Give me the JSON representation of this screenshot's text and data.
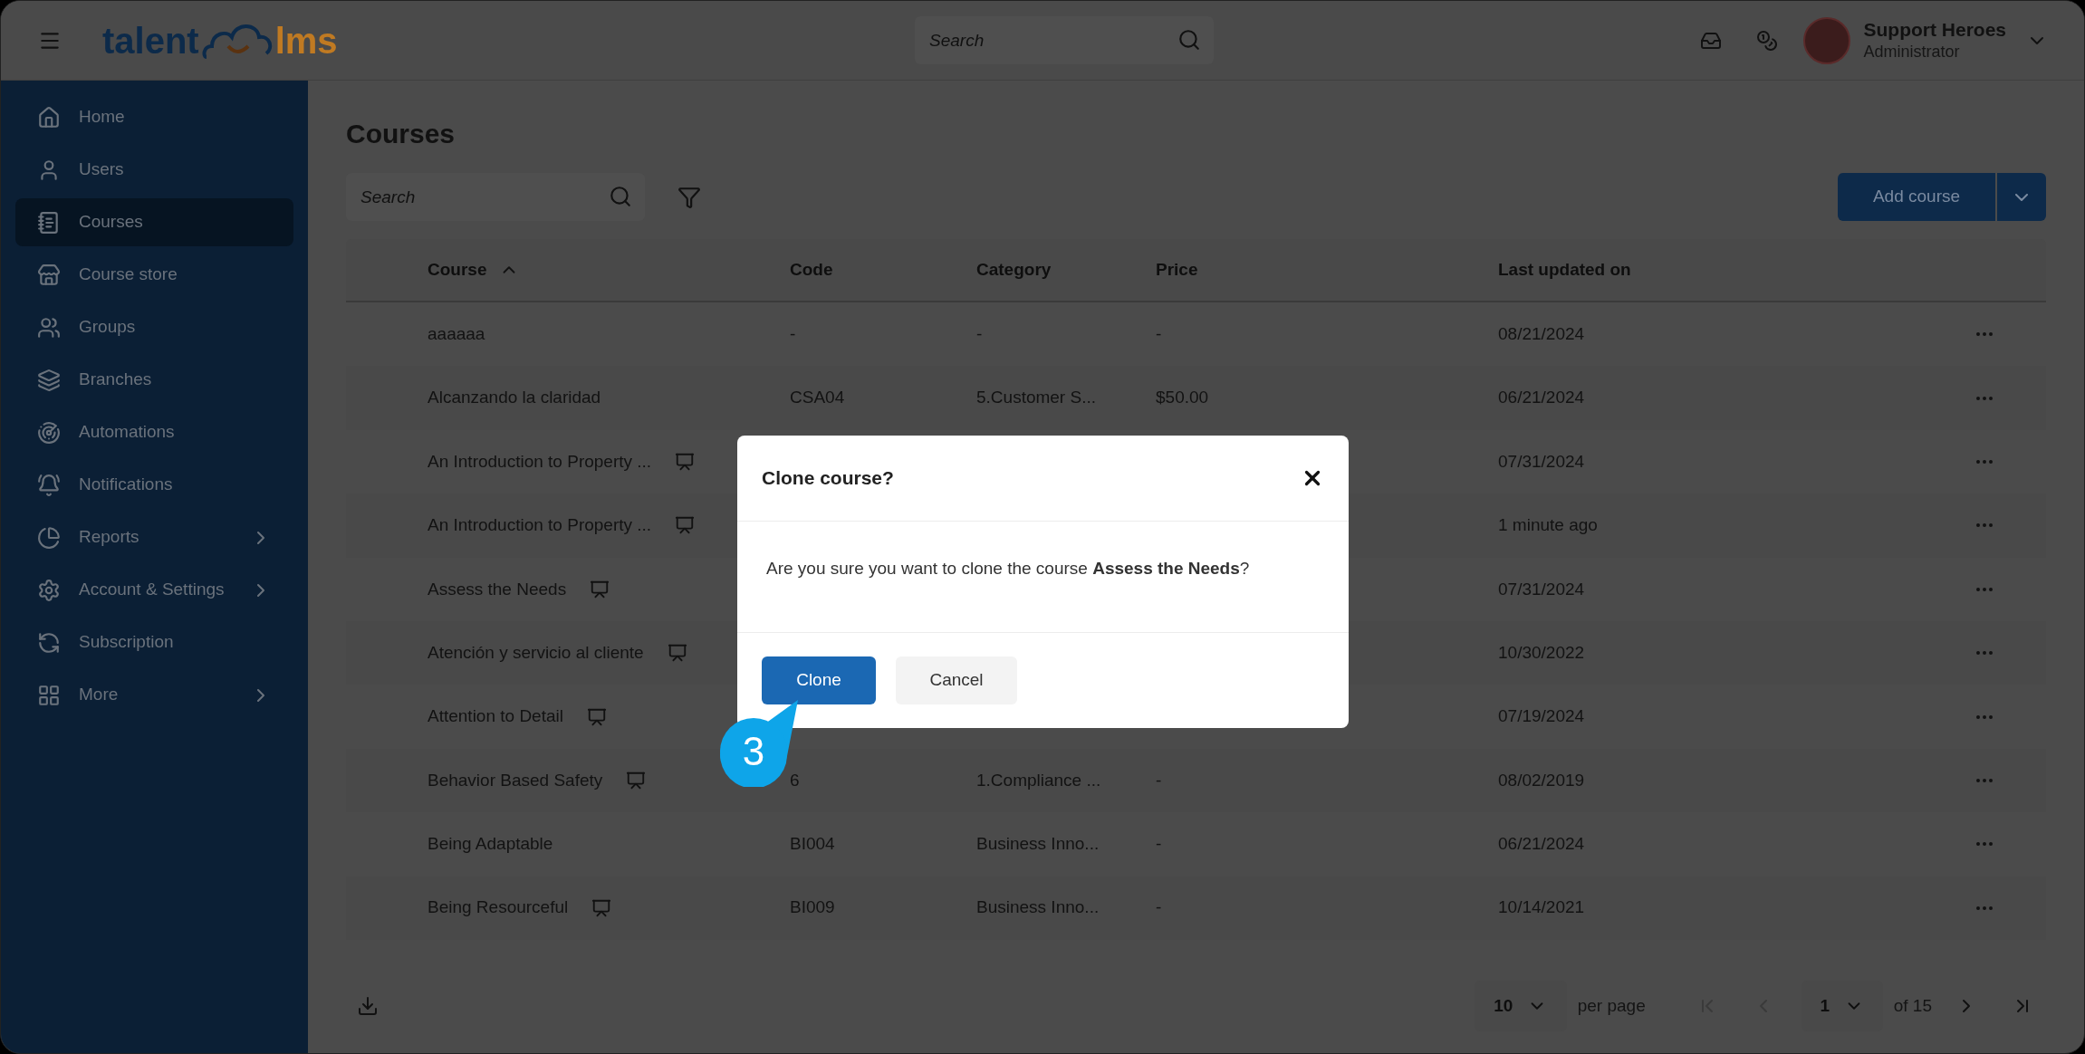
{
  "header": {
    "logo_left": "talent",
    "logo_right": "lms",
    "search_placeholder": "Search",
    "user": {
      "name": "Support Heroes",
      "role": "Administrator"
    }
  },
  "sidebar": {
    "items": [
      {
        "label": "Home",
        "selected": false,
        "has_submenu": false
      },
      {
        "label": "Users",
        "selected": false,
        "has_submenu": false
      },
      {
        "label": "Courses",
        "selected": true,
        "has_submenu": false
      },
      {
        "label": "Course store",
        "selected": false,
        "has_submenu": false
      },
      {
        "label": "Groups",
        "selected": false,
        "has_submenu": false
      },
      {
        "label": "Branches",
        "selected": false,
        "has_submenu": false
      },
      {
        "label": "Automations",
        "selected": false,
        "has_submenu": false
      },
      {
        "label": "Notifications",
        "selected": false,
        "has_submenu": false
      },
      {
        "label": "Reports",
        "selected": false,
        "has_submenu": true
      },
      {
        "label": "Account & Settings",
        "selected": false,
        "has_submenu": true
      },
      {
        "label": "Subscription",
        "selected": false,
        "has_submenu": false
      },
      {
        "label": "More",
        "selected": false,
        "has_submenu": true
      }
    ]
  },
  "page": {
    "title": "Courses",
    "search_placeholder": "Search",
    "add_button": "Add course"
  },
  "table": {
    "columns": [
      {
        "label": "Course",
        "sorted": true
      },
      {
        "label": "Code",
        "sorted": false
      },
      {
        "label": "Category",
        "sorted": false
      },
      {
        "label": "Price",
        "sorted": false
      },
      {
        "label": "Last updated on",
        "sorted": false
      }
    ],
    "rows": [
      {
        "course": "aaaaaa",
        "has_icon": false,
        "code": "-",
        "category": "-",
        "price": "-",
        "updated": "08/21/2024"
      },
      {
        "course": "Alcanzando la claridad",
        "has_icon": false,
        "code": "CSA04",
        "category": "5.Customer S...",
        "price": "$50.00",
        "updated": "06/21/2024"
      },
      {
        "course": "An Introduction to Property ...",
        "has_icon": true,
        "updated": "07/31/2024"
      },
      {
        "course": "An Introduction to Property ...",
        "has_icon": true,
        "updated": "1 minute ago"
      },
      {
        "course": "Assess the Needs",
        "has_icon": true,
        "updated": "07/31/2024"
      },
      {
        "course": "Atención y servicio al cliente",
        "has_icon": true,
        "updated": "10/30/2022"
      },
      {
        "course": "Attention to Detail",
        "has_icon": true,
        "updated": "07/19/2024"
      },
      {
        "course": "Behavior Based Safety",
        "has_icon": true,
        "code": "6",
        "category": "1.Compliance ...",
        "price": "-",
        "updated": "08/02/2019"
      },
      {
        "course": "Being Adaptable",
        "has_icon": false,
        "code": "BI004",
        "category": "Business Inno...",
        "price": "-",
        "updated": "06/21/2024"
      },
      {
        "course": "Being Resourceful",
        "has_icon": true,
        "code": "BI009",
        "category": "Business Inno...",
        "price": "-",
        "updated": "10/14/2021"
      }
    ]
  },
  "footer": {
    "per_page": "10",
    "per_page_label": "per page",
    "page": "1",
    "of_pages": "of 15"
  },
  "modal": {
    "title": "Clone course?",
    "message": "Are you sure you want to clone the course **Assess the Needs**?",
    "buttons": [
      {
        "label": "Clone",
        "kind": "primary"
      },
      {
        "label": "Cancel",
        "kind": "secondary"
      }
    ]
  },
  "callout": {
    "number": "3"
  }
}
